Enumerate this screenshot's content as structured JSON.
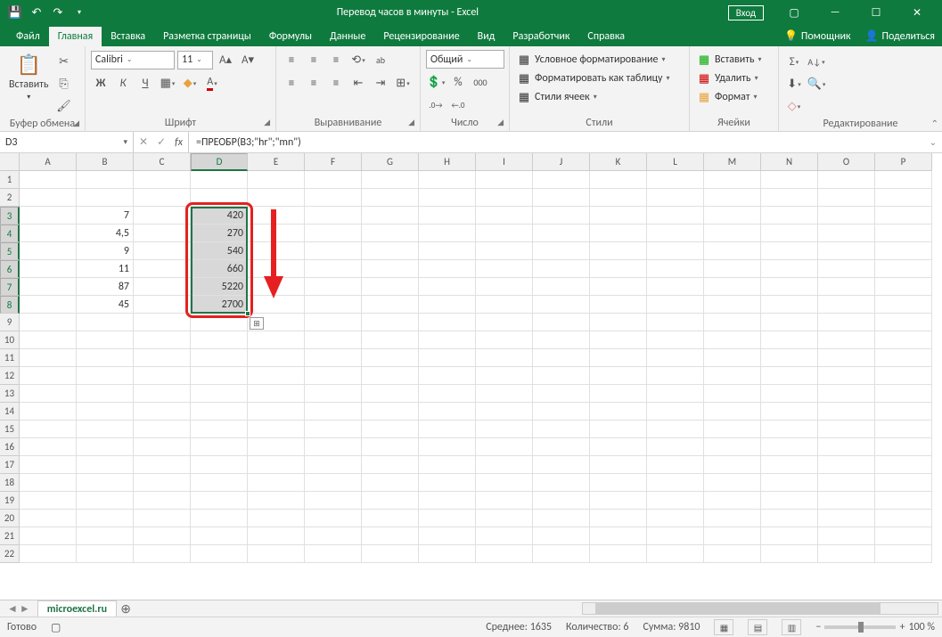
{
  "title": "Перевод часов в минуты  -  Excel",
  "qat_login": "Вход",
  "tabs": [
    "Файл",
    "Главная",
    "Вставка",
    "Разметка страницы",
    "Формулы",
    "Данные",
    "Рецензирование",
    "Вид",
    "Разработчик",
    "Справка"
  ],
  "tabs_active_idx": 1,
  "assist": "Помощник",
  "share": "Поделиться",
  "clipboard": {
    "paste": "Вставить",
    "label": "Буфер обмена"
  },
  "font": {
    "name": "Calibri",
    "size": "11",
    "bold": "Ж",
    "italic": "К",
    "underline": "Ч",
    "label": "Шрифт"
  },
  "align": {
    "label": "Выравнивание"
  },
  "number": {
    "format": "Общий",
    "label": "Число"
  },
  "styles": {
    "cond": "Условное форматирование",
    "table": "Форматировать как таблицу",
    "cell": "Стили ячеек",
    "label": "Стили"
  },
  "cells": {
    "insert": "Вставить",
    "delete": "Удалить",
    "format": "Формат",
    "label": "Ячейки"
  },
  "editing": {
    "label": "Редактирование"
  },
  "namebox": "D3",
  "formula": "=ПРЕОБР(B3;\"hr\";\"mn\")",
  "columns": [
    "A",
    "B",
    "C",
    "D",
    "E",
    "F",
    "G",
    "H",
    "I",
    "J",
    "K",
    "L",
    "M",
    "N",
    "O",
    "P"
  ],
  "rows": 22,
  "data_b": {
    "3": "7",
    "4": "4,5",
    "5": "9",
    "6": "11",
    "7": "87",
    "8": "45"
  },
  "data_d": {
    "3": "420",
    "4": "270",
    "5": "540",
    "6": "660",
    "7": "5220",
    "8": "2700"
  },
  "sel_col": "D",
  "sel_rows": [
    3,
    8
  ],
  "sheet": "microexcel.ru",
  "status": {
    "ready": "Готово",
    "avg": "Среднее: 1635",
    "count": "Количество: 6",
    "sum": "Сумма: 9810",
    "zoom": "100 %"
  }
}
